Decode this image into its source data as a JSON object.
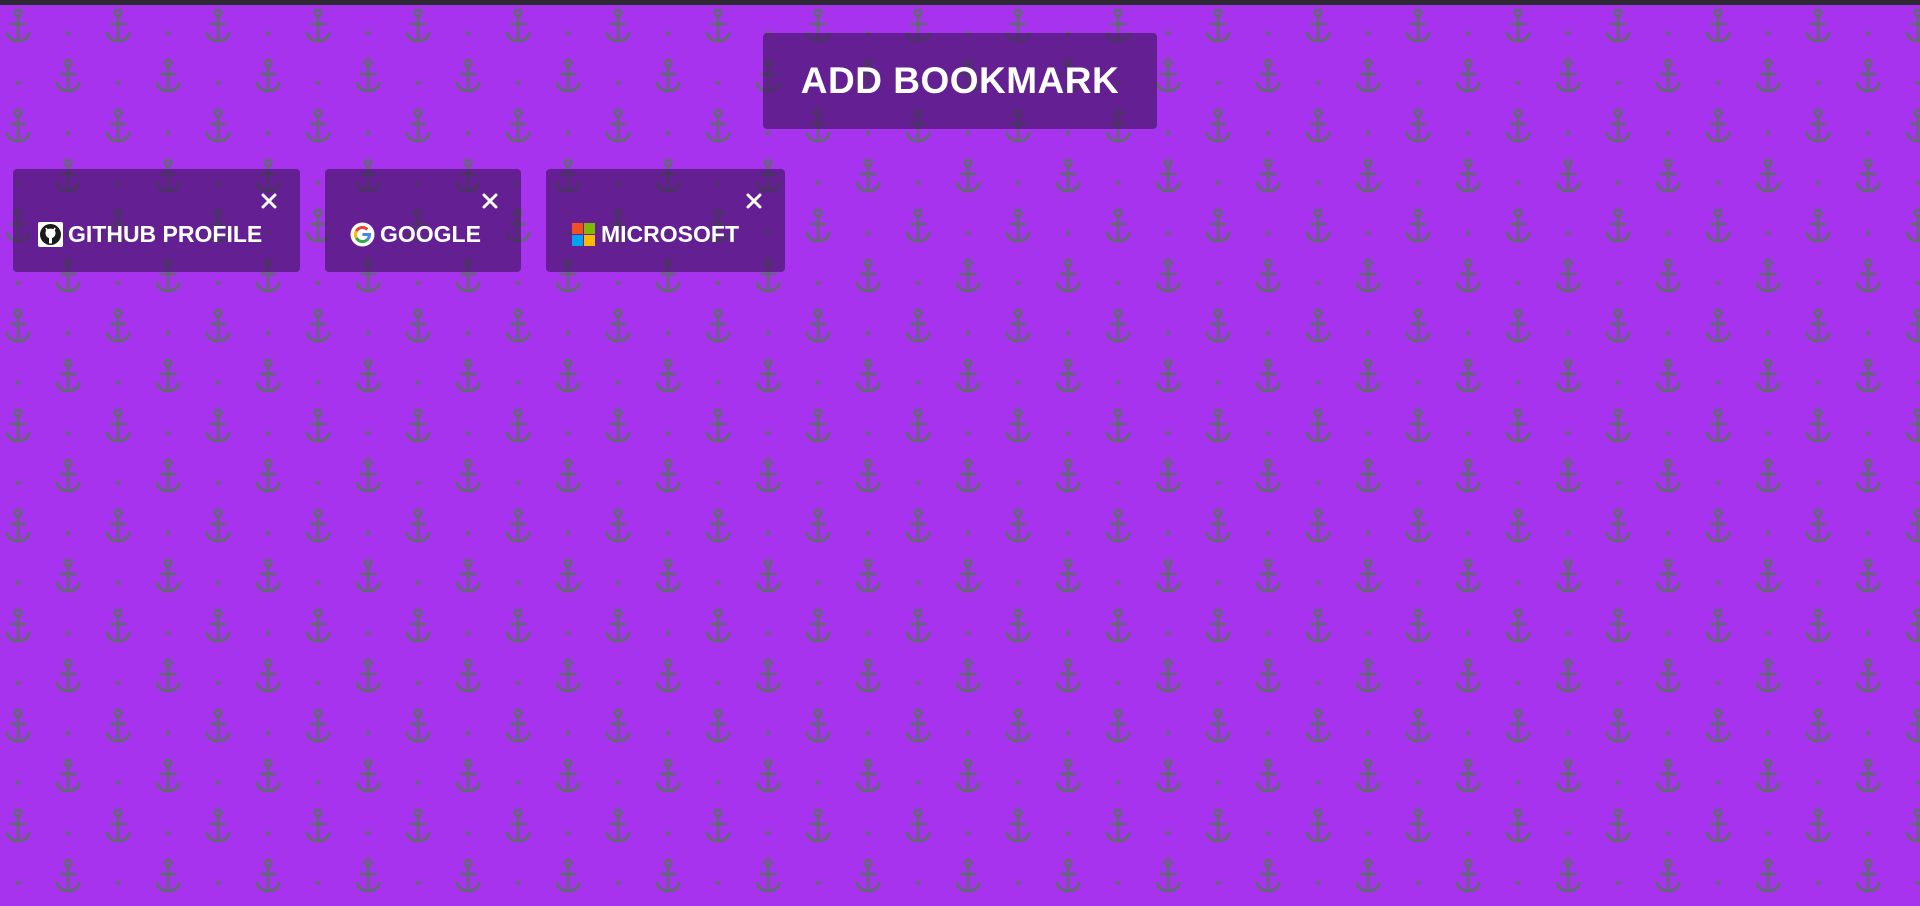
{
  "page": {
    "background_color": "#a733ee",
    "pattern_icon": "anchor-icon"
  },
  "header": {
    "add_bookmark_label": "ADD BOOKMARK"
  },
  "bookmarks": [
    {
      "label": "GITHUB PROFILE",
      "icon": "github-icon",
      "close_icon": "close-icon"
    },
    {
      "label": "GOOGLE",
      "icon": "google-icon",
      "close_icon": "close-icon"
    },
    {
      "label": "MICROSOFT",
      "icon": "microsoft-icon",
      "close_icon": "close-icon"
    }
  ]
}
